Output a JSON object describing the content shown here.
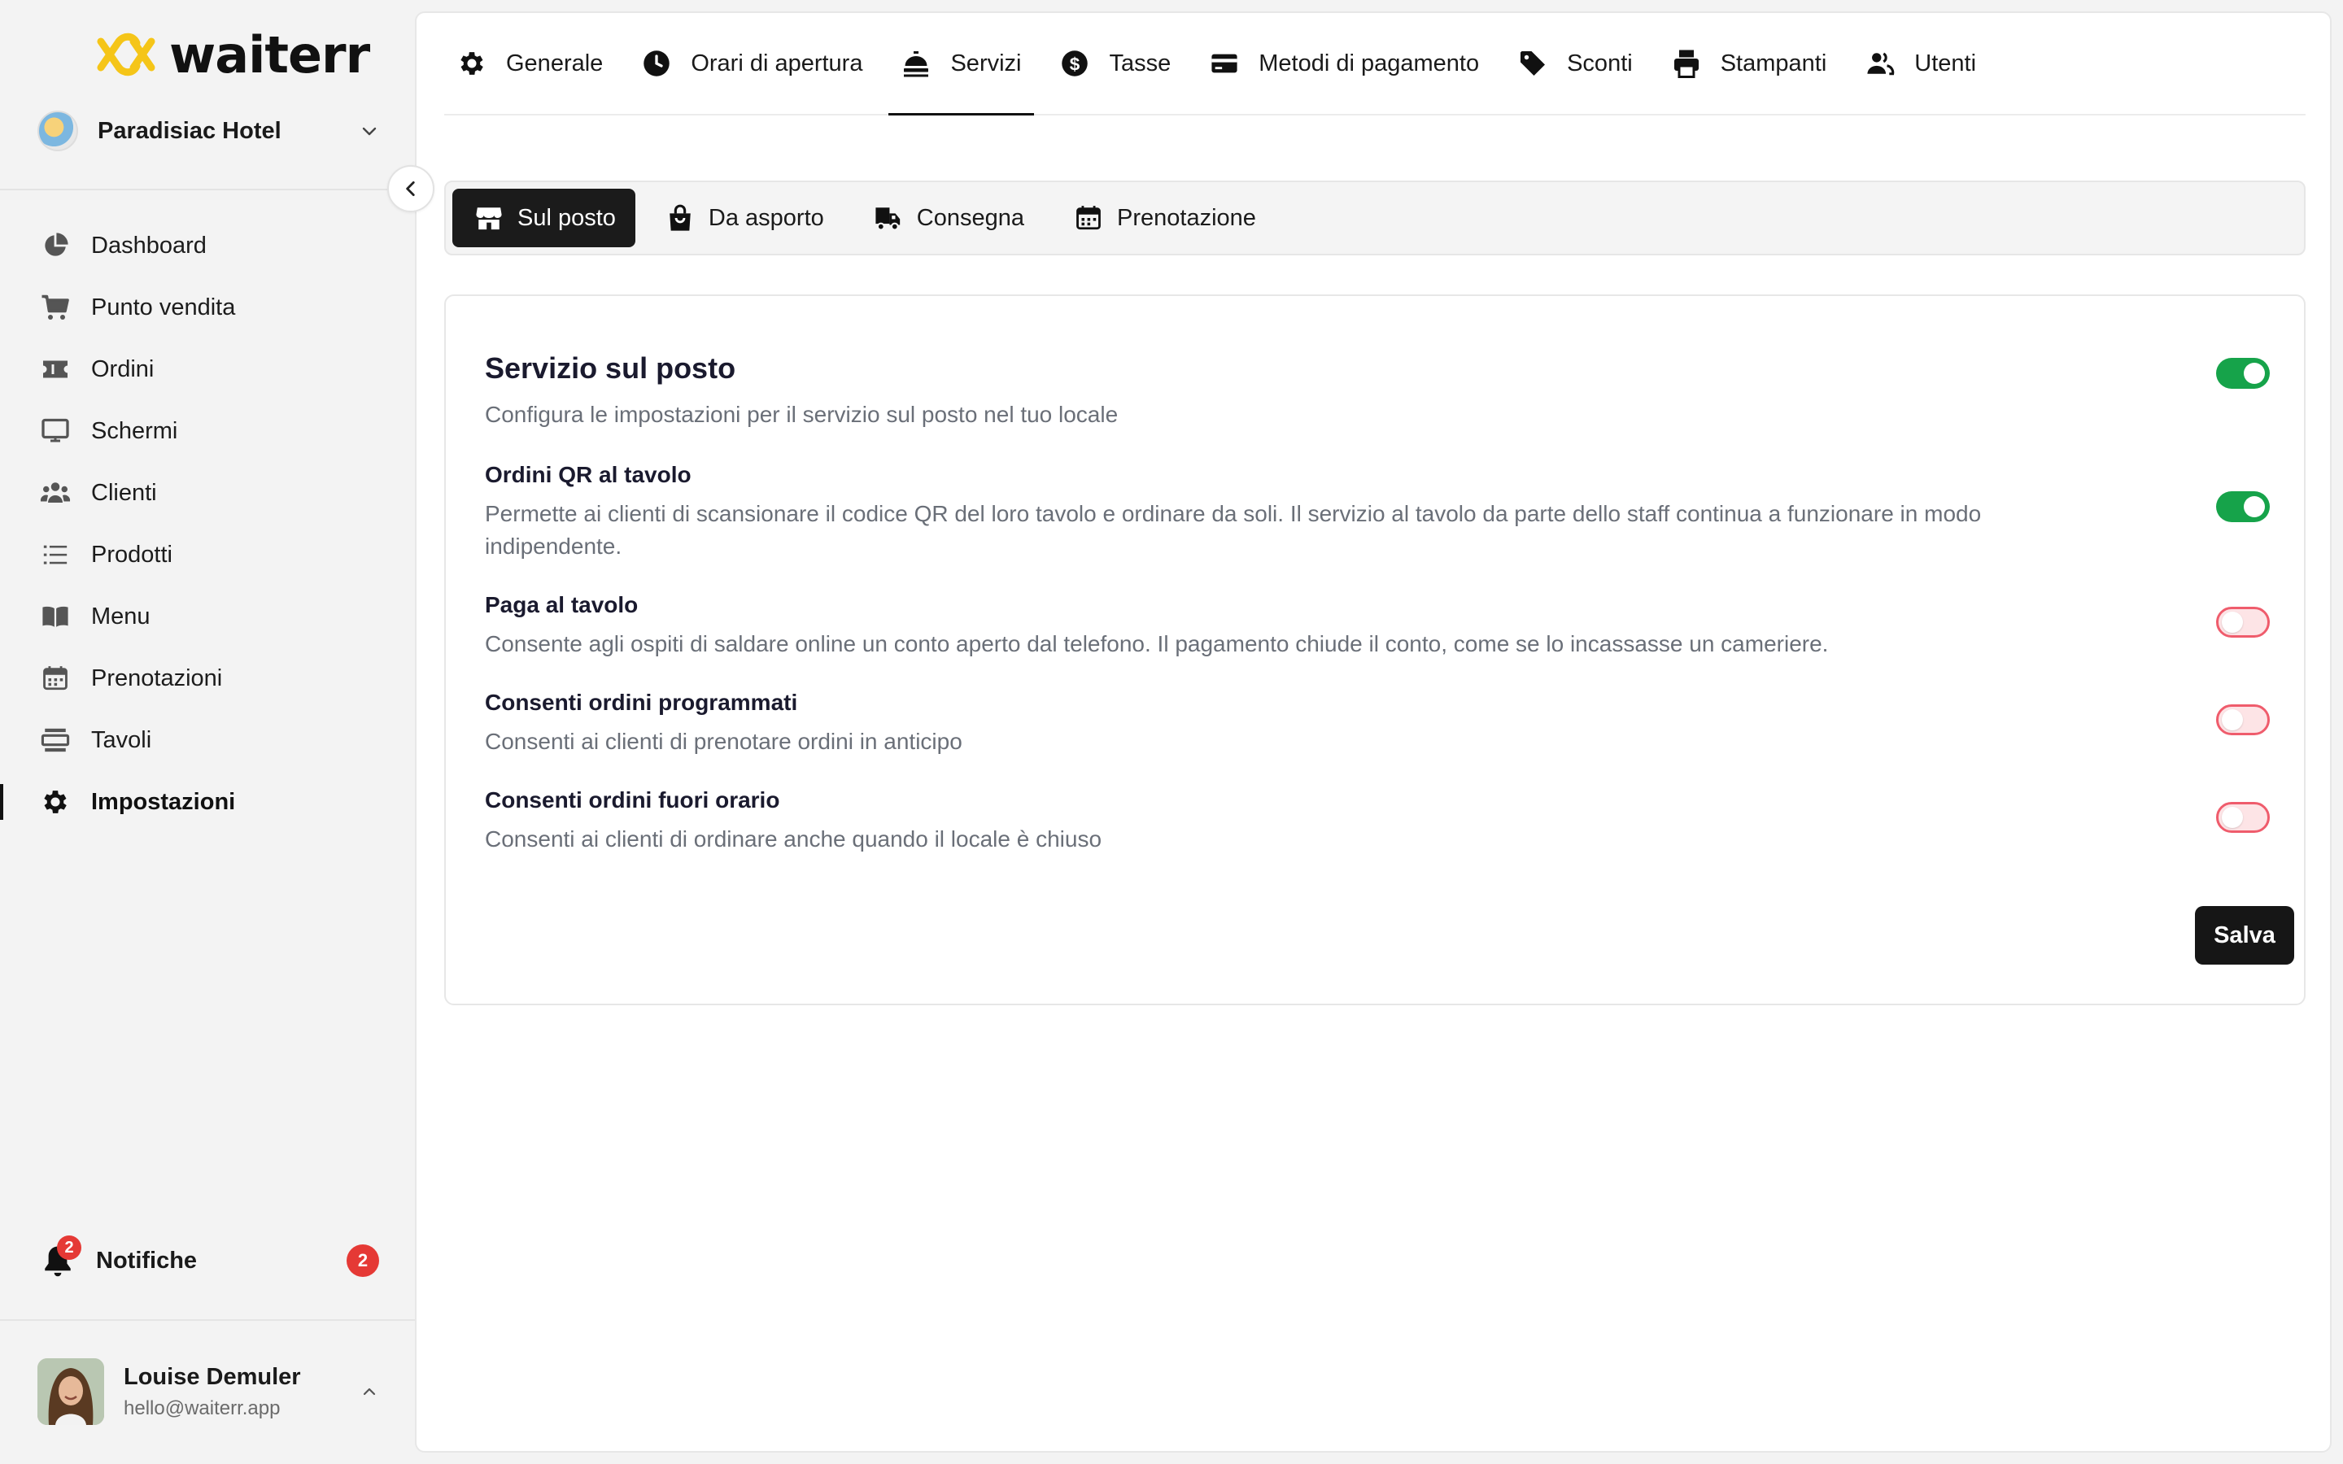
{
  "brand": {
    "name": "waiterr",
    "accent": "#f5c518"
  },
  "venue": {
    "name": "Paradisiac Hotel"
  },
  "sidebar": {
    "items": [
      {
        "label": "Dashboard",
        "icon": "pie-chart-icon"
      },
      {
        "label": "Punto vendita",
        "icon": "cart-icon"
      },
      {
        "label": "Ordini",
        "icon": "ticket-icon"
      },
      {
        "label": "Schermi",
        "icon": "monitor-icon"
      },
      {
        "label": "Clienti",
        "icon": "users-icon"
      },
      {
        "label": "Prodotti",
        "icon": "list-icon"
      },
      {
        "label": "Menu",
        "icon": "book-icon"
      },
      {
        "label": "Prenotazioni",
        "icon": "calendar-icon"
      },
      {
        "label": "Tavoli",
        "icon": "table-icon"
      },
      {
        "label": "Impostazioni",
        "icon": "gear-icon",
        "active": true
      }
    ],
    "notifications": {
      "label": "Notifiche",
      "badge": "2",
      "count": "2"
    },
    "user": {
      "name": "Louise Demuler",
      "email": "hello@waiterr.app"
    }
  },
  "tabs": [
    {
      "label": "Generale",
      "icon": "gear-icon"
    },
    {
      "label": "Orari di apertura",
      "icon": "clock-icon"
    },
    {
      "label": "Servizi",
      "icon": "service-bell-icon",
      "active": true
    },
    {
      "label": "Tasse",
      "icon": "dollar-icon"
    },
    {
      "label": "Metodi di pagamento",
      "icon": "credit-card-icon"
    },
    {
      "label": "Sconti",
      "icon": "tag-icon"
    },
    {
      "label": "Stampanti",
      "icon": "printer-icon"
    },
    {
      "label": "Utenti",
      "icon": "users-icon"
    }
  ],
  "subtabs": [
    {
      "label": "Sul posto",
      "icon": "storefront-icon",
      "active": true
    },
    {
      "label": "Da asporto",
      "icon": "shopping-bag-icon"
    },
    {
      "label": "Consegna",
      "icon": "truck-icon"
    },
    {
      "label": "Prenotazione",
      "icon": "calendar-icon"
    }
  ],
  "card": {
    "title": "Servizio sul posto",
    "subtitle": "Configura le impostazioni per il servizio sul posto nel tuo locale",
    "enabled": true,
    "settings": [
      {
        "title": "Ordini QR al tavolo",
        "description": "Permette ai clienti di scansionare il codice QR del loro tavolo e ordinare da soli. Il servizio al tavolo da parte dello staff continua a funzionare in modo indipendente.",
        "enabled": true
      },
      {
        "title": "Paga al tavolo",
        "description": "Consente agli ospiti di saldare online un conto aperto dal telefono. Il pagamento chiude il conto, come se lo incassasse un cameriere.",
        "enabled": false
      },
      {
        "title": "Consenti ordini programmati",
        "description": "Consenti ai clienti di prenotare ordini in anticipo",
        "enabled": false
      },
      {
        "title": "Consenti ordini fuori orario",
        "description": "Consenti ai clienti di ordinare anche quando il locale è chiuso",
        "enabled": false
      }
    ],
    "save_label": "Salva"
  },
  "colors": {
    "toggle_on": "#16a34a",
    "toggle_off": "#ef5c6c",
    "badge": "#e53935"
  }
}
